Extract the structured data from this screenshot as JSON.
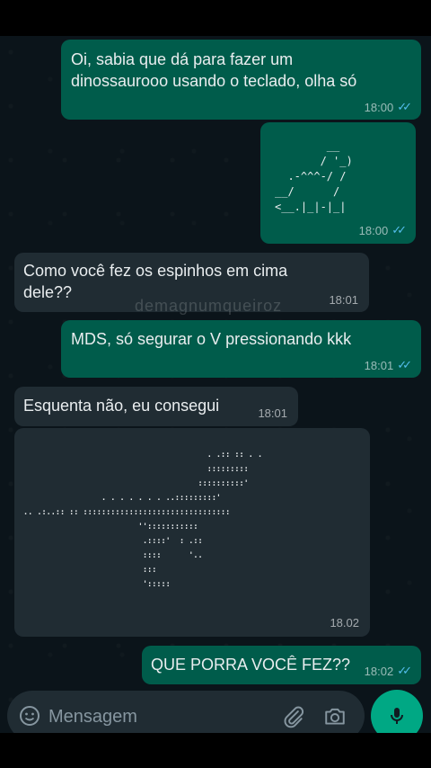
{
  "messages": [
    {
      "text": "Oi, sabia que dá para fazer um\ndinossaurooo usando o teclado, olha só",
      "time": "18:00"
    },
    {
      "ascii": "        __\n       / '_)\n  .-^^^-/ /\n__/      /\n<__.|_|-|_|",
      "time": "18:00"
    },
    {
      "text": "Como você fez os espinhos em cima\ndele??",
      "time": "18:01"
    },
    {
      "text": "MDS, só segurar o V pressionando kkk",
      "time": "18:01"
    },
    {
      "text": "Esquenta não, eu consegui",
      "time": "18:01"
    },
    {
      "ascii": "                                        . .:: :: . .\n                                        :::::::::\n                                      ::::::::::'\n                 . . . . . . . ..:::::::::'\n.. .:..:: :: ::::::::::::::::::::::::::::::::\n                         '':::::::::::\n                          .::::'  : .::\n                          ::::      '..\n                          :::\n                          ':::::",
      "time": "18.02"
    },
    {
      "text": "QUE PORRA VOCÊ FEZ??",
      "time": "18:02"
    }
  ],
  "watermark": "demagnumqueiroz",
  "composer": {
    "placeholder": "Mensagem"
  },
  "icons": {
    "emoji": "emoji-icon",
    "attach": "paperclip-icon",
    "camera": "camera-icon",
    "mic": "microphone-icon",
    "read": "double-check-icon"
  },
  "colors": {
    "outgoing": "#005c4b",
    "incoming": "#202c33",
    "background": "#0b141a",
    "accent": "#00a884",
    "read_ticks": "#53bdeb"
  }
}
